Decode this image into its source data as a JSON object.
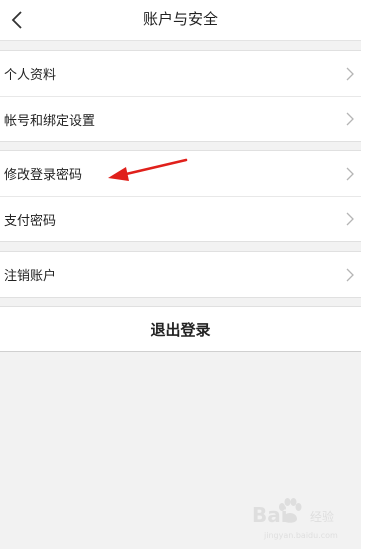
{
  "header": {
    "title": "账户与安全",
    "back_icon": "chevron-left-icon"
  },
  "sections": [
    {
      "items": [
        {
          "label": "个人资料"
        },
        {
          "label": "帐号和绑定设置"
        }
      ]
    },
    {
      "items": [
        {
          "label": "修改登录密码"
        },
        {
          "label": "支付密码"
        }
      ]
    },
    {
      "items": [
        {
          "label": "注销账户"
        }
      ]
    }
  ],
  "logout": {
    "label": "退出登录"
  },
  "annotation": {
    "type": "arrow",
    "color": "#e0201b",
    "points_to": "修改登录密码"
  },
  "watermark": {
    "brand": "Bai",
    "brand_suffix": "经验",
    "url": "jingyan.baidu.com"
  },
  "colors": {
    "background": "#f2f2f2",
    "surface": "#ffffff",
    "chevron": "#b5b5b5",
    "annotation": "#e0201b"
  }
}
